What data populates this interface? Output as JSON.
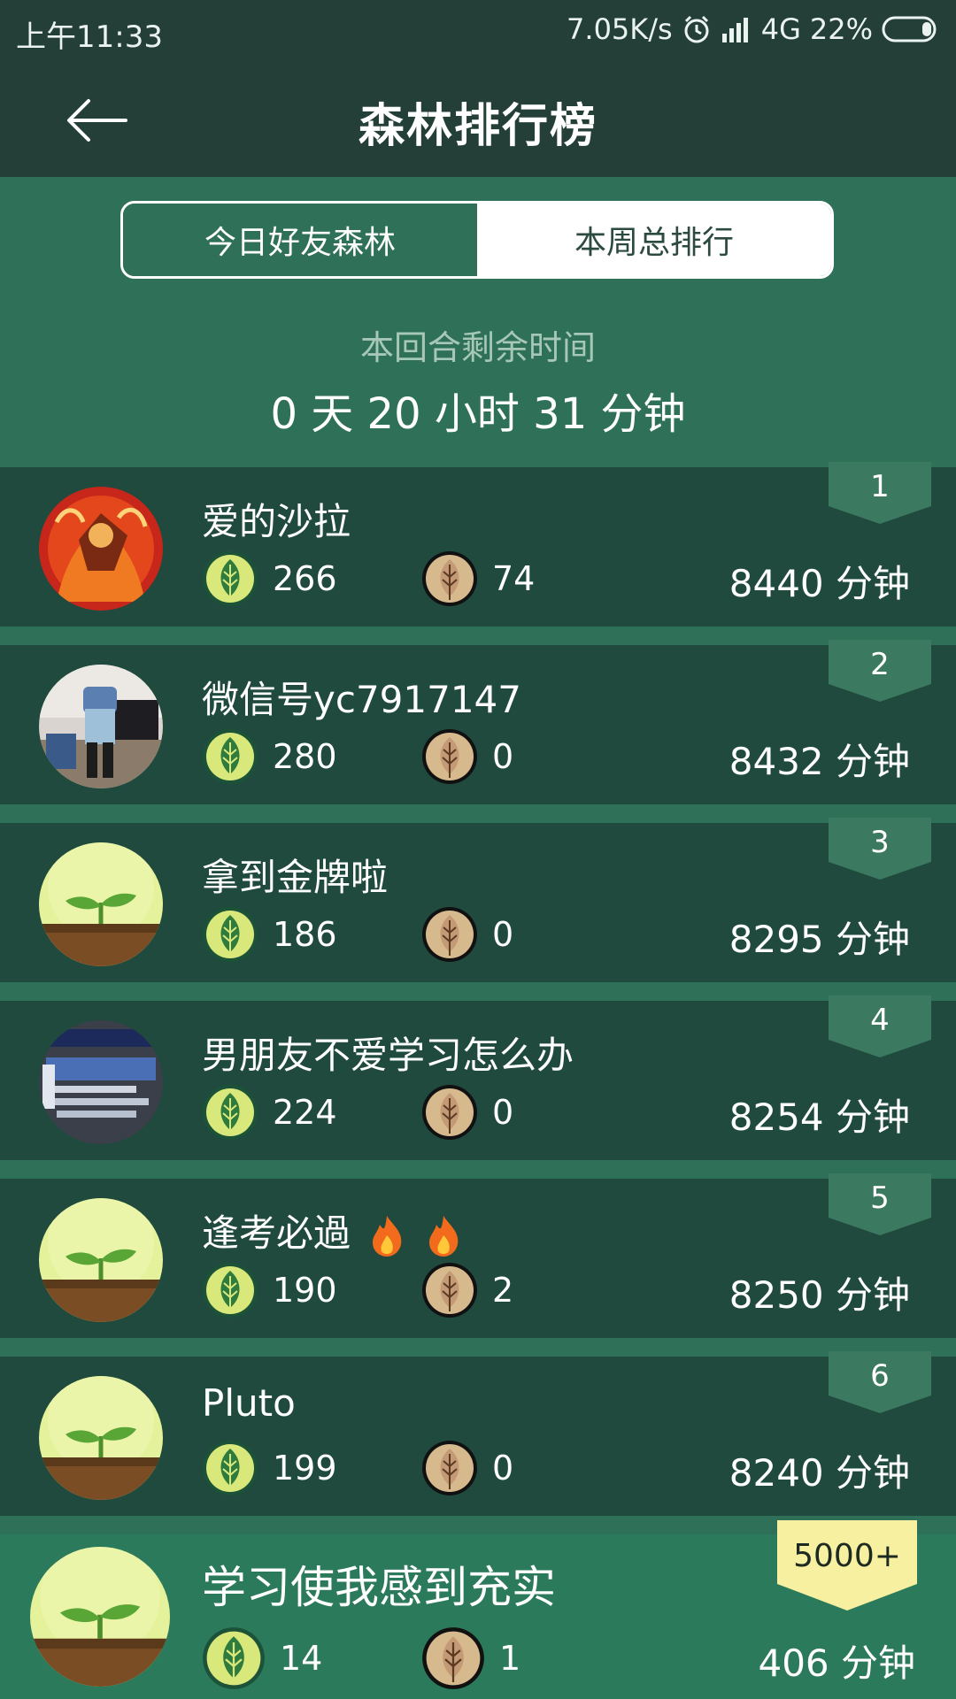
{
  "status_bar": {
    "time": "上午11:33",
    "network_speed": "7.05K/s",
    "network_type": "4G",
    "battery": "22%"
  },
  "header": {
    "title": "森林排行榜",
    "back_icon": "arrow-left-icon"
  },
  "tabs": [
    {
      "label": "今日好友森林",
      "active": true
    },
    {
      "label": "本周总排行",
      "active": false
    }
  ],
  "countdown": {
    "label": "本回合剩余时间",
    "value": "0 天 20 小时 31 分钟"
  },
  "colors": {
    "bg": "#2f7158",
    "header": "#243f38",
    "row": "#1f4a3d",
    "self_row": "#2c7a5c",
    "self_rank_badge": "#f7f0a0",
    "live_coin": "#d9e87a",
    "dead_coin": "#d7b98e"
  },
  "leaderboard": [
    {
      "rank": "1",
      "name": "爱的沙拉",
      "live": "266",
      "dead": "74",
      "minutes": "8440 分钟",
      "avatar": "photo-fire-warrior"
    },
    {
      "rank": "2",
      "name": "微信号yc7917147",
      "live": "280",
      "dead": "0",
      "minutes": "8432 分钟",
      "avatar": "photo-person-standing"
    },
    {
      "rank": "3",
      "name": "拿到金牌啦",
      "live": "186",
      "dead": "0",
      "minutes": "8295 分钟",
      "avatar": "sprout-icon"
    },
    {
      "rank": "4",
      "name": "男朋友不爱学习怎么办",
      "live": "224",
      "dead": "0",
      "minutes": "8254 分钟",
      "avatar": "photo-text-collage"
    },
    {
      "rank": "5",
      "name": "逢考必過",
      "live": "190",
      "dead": "2",
      "minutes": "8250 分钟",
      "avatar": "sprout-icon",
      "emoji": "fire-icon"
    },
    {
      "rank": "6",
      "name": "Pluto",
      "live": "199",
      "dead": "0",
      "minutes": "8240 分钟",
      "avatar": "sprout-icon"
    }
  ],
  "self": {
    "rank": "5000+",
    "name": "学习使我感到充实",
    "live": "14",
    "dead": "1",
    "minutes": "406 分钟",
    "avatar": "sprout-icon"
  }
}
